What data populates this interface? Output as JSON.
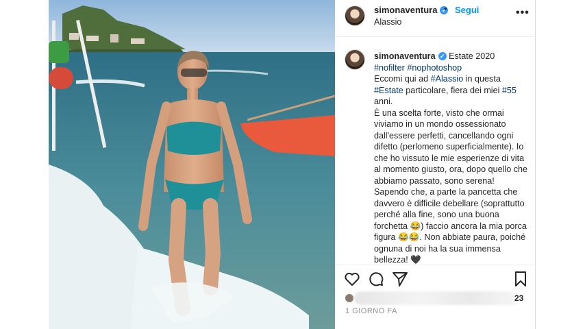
{
  "post": {
    "username": "simonaventura",
    "follow_label": "Segui",
    "dot_separator": "•",
    "location": "Alassio",
    "more_label": "•••",
    "verified_mark": "✓"
  },
  "caption": {
    "username": "simonaventura",
    "intro": "Estate 2020",
    "hashtag_nofilter": "#nofilter",
    "hashtag_nophotoshop": "#nophotoshop",
    "part1": "Eccomi qui ad ",
    "hashtag_alassio": "#Alassio",
    "part2": " in questa ",
    "hashtag_estate": "#Estate",
    "part3": " particolare, fiera dei miei ",
    "hashtag_55": "#55",
    "part4": " anni.\nÈ una scelta forte, visto che ormai viviamo in un mondo ossessionato dall'essere perfetti, cancellando ogni difetto (perlomeno superficialmente). Io che ho vissuto le mie esperienze di vita al momento giusto, ora, dopo quello che abbiamo passato, sono serena! Sapendo che, a parte la pancetta che davvero è difficile debellare (soprattutto perché alla fine, sono una buona forchetta 😂) faccio ancora la mia porca figura 😂😂. Non abbiate paura, poiché ognuna di noi ha la sua immensa bellezza! 🖤"
  },
  "actions": {
    "like_icon": "heart-icon",
    "comment_icon": "comment-icon",
    "share_icon": "paper-plane-icon",
    "save_icon": "bookmark-icon",
    "likes_suffix": "23",
    "time_ago": "1 GIORNO FA"
  },
  "colors": {
    "link_blue": "#0095f6",
    "hashtag": "#00376b",
    "verified": "#3897f0",
    "muted": "#8e8e8e"
  }
}
